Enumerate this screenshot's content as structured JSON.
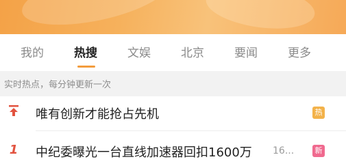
{
  "tabs": [
    {
      "label": "我的",
      "active": false
    },
    {
      "label": "热搜",
      "active": true
    },
    {
      "label": "文娱",
      "active": false
    },
    {
      "label": "北京",
      "active": false
    },
    {
      "label": "要闻",
      "active": false
    },
    {
      "label": "更多",
      "active": false
    }
  ],
  "tip": "实时热点，每分钟更新一次",
  "items": [
    {
      "rank": "",
      "rank_icon": "pin-top-icon",
      "title": "唯有创新才能抢占先机",
      "count": "",
      "badge": "热",
      "badge_color": "#f3b24a"
    },
    {
      "rank": "1",
      "rank_icon": "",
      "title": "中纪委曝光一台直线加速器回扣1600万",
      "count": "16...",
      "badge": "新",
      "badge_color": "#f06a8f"
    }
  ],
  "colors": {
    "accent": "#f39c3c",
    "rank_red": "#e2533f",
    "hot_badge": "#f3b24a",
    "new_badge": "#f06a8f"
  }
}
